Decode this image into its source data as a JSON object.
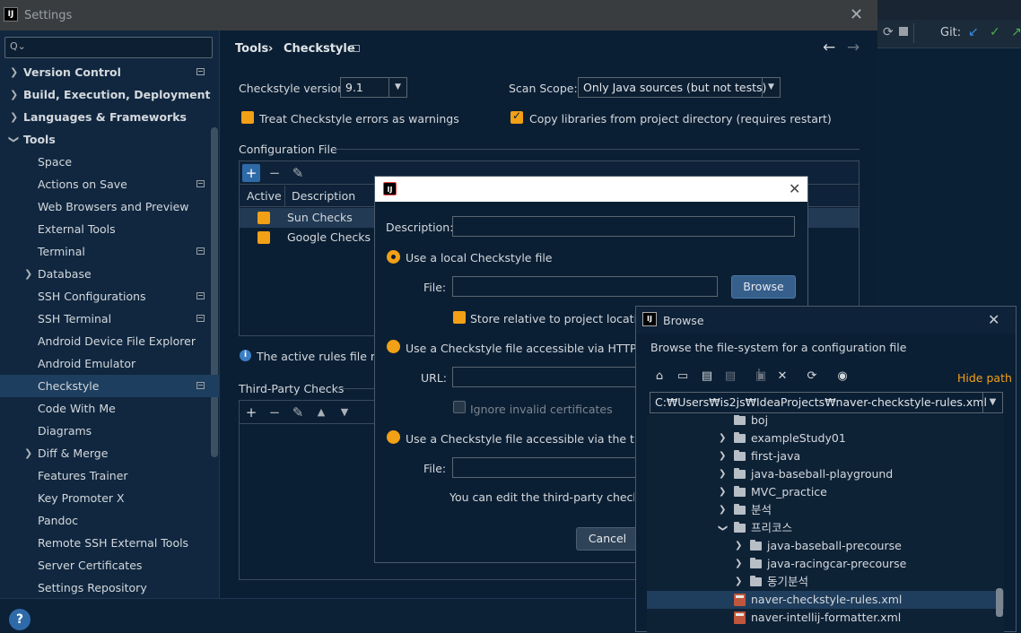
{
  "settings": {
    "title": "Settings",
    "app_icon_text": "IJ",
    "search_placeholder": ""
  },
  "sidebar": {
    "items": [
      {
        "label": "Version Control"
      },
      {
        "label": "Build, Execution, Deployment"
      },
      {
        "label": "Languages & Frameworks"
      },
      {
        "label": "Tools"
      },
      {
        "label": "Space"
      },
      {
        "label": "Actions on Save"
      },
      {
        "label": "Web Browsers and Preview"
      },
      {
        "label": "External Tools"
      },
      {
        "label": "Terminal"
      },
      {
        "label": "Database"
      },
      {
        "label": "SSH Configurations"
      },
      {
        "label": "SSH Terminal"
      },
      {
        "label": "Android Device File Explorer"
      },
      {
        "label": "Android Emulator"
      },
      {
        "label": "Checkstyle"
      },
      {
        "label": "Code With Me"
      },
      {
        "label": "Diagrams"
      },
      {
        "label": "Diff & Merge"
      },
      {
        "label": "Features Trainer"
      },
      {
        "label": "Key Promoter X"
      },
      {
        "label": "Pandoc"
      },
      {
        "label": "Remote SSH External Tools"
      },
      {
        "label": "Server Certificates"
      },
      {
        "label": "Settings Repository"
      }
    ]
  },
  "main": {
    "breadcrumb": {
      "parent": "Tools",
      "separator": "›",
      "current": "Checkstyle"
    },
    "version_label": "Checkstyle version:",
    "version_value": "9.1",
    "scope_label": "Scan Scope:",
    "scope_value": "Only Java sources (but not tests)",
    "treat_errors_label": "Treat Checkstyle errors as warnings",
    "copy_libs_label": "Copy libraries from project directory (requires restart)",
    "config_section": "Configuration File",
    "config_columns": {
      "active": "Active",
      "description": "Description"
    },
    "config_rows": [
      {
        "name": "Sun Checks"
      },
      {
        "name": "Google Checks"
      }
    ],
    "info_text": "The active rules file may",
    "third_party_section": "Third-Party Checks"
  },
  "ide": {
    "git_label": "Git:"
  },
  "dialog": {
    "description_label": "Description:",
    "description_value": "",
    "local_option": "Use a local Checkstyle file",
    "file_label": "File:",
    "browse_button": "Browse",
    "store_relative": "Store relative to project location",
    "http_option": "Use a Checkstyle file accessible via HTTP",
    "url_label": "URL:",
    "ignore_certs": "Ignore invalid certificates",
    "third_party_option": "Use a Checkstyle file accessible via the third-pa",
    "file_label2": "File:",
    "third_party_note": "You can edit the third-party checks in",
    "cancel_button": "Cancel"
  },
  "browse": {
    "title": "Browse",
    "subtitle": "Browse the file-system for a configuration file",
    "hide_path": "Hide path",
    "path_value": "C:₩Users₩is2js₩IdeaProjects₩naver-checkstyle-rules.xml",
    "tree": [
      {
        "label": "boj",
        "type": "folder"
      },
      {
        "label": "exampleStudy01",
        "type": "folder"
      },
      {
        "label": "first-java",
        "type": "folder"
      },
      {
        "label": "java-baseball-playground",
        "type": "folder"
      },
      {
        "label": "MVC_practice",
        "type": "folder"
      },
      {
        "label": "분석",
        "type": "folder"
      },
      {
        "label": "프리코스",
        "type": "folder"
      },
      {
        "label": "java-baseball-precourse",
        "type": "folder"
      },
      {
        "label": "java-racingcar-precourse",
        "type": "folder"
      },
      {
        "label": "동기분석",
        "type": "folder"
      },
      {
        "label": "naver-checkstyle-rules.xml",
        "type": "xml"
      },
      {
        "label": "naver-intellij-formatter.xml",
        "type": "xml"
      }
    ]
  },
  "help": {
    "label": "?"
  },
  "colors": {
    "accent": "#f2a016",
    "selection": "#1d3e5e",
    "button_blue": "#365f8c"
  }
}
